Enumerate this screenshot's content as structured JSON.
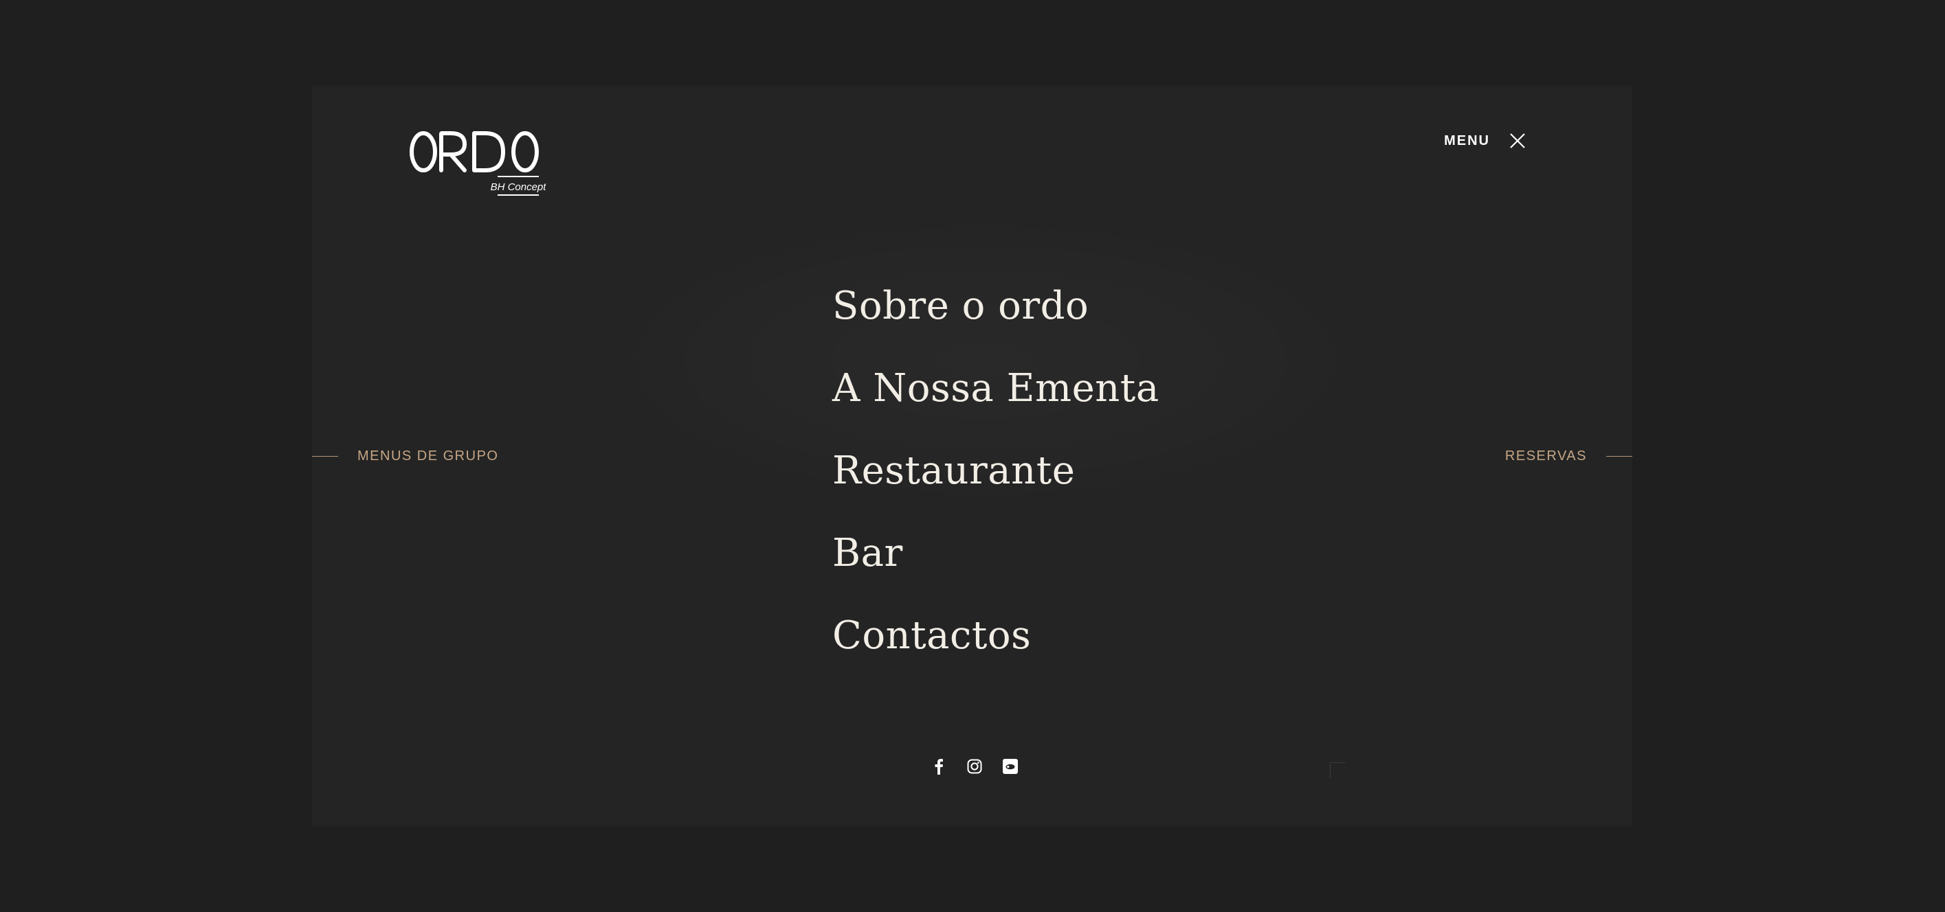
{
  "brand": {
    "name": "ORDO",
    "tagline": "BH Concept"
  },
  "header": {
    "menu_label": "MENU",
    "close_icon": "close-icon"
  },
  "side_links": {
    "left": "MENUS DE GRUPO",
    "right": "RESERVAS"
  },
  "nav": {
    "items": [
      {
        "label": "Sobre o ordo"
      },
      {
        "label": "A Nossa Ementa"
      },
      {
        "label": "Restaurante"
      },
      {
        "label": "Bar"
      },
      {
        "label": "Contactos"
      }
    ]
  },
  "social": {
    "icons": [
      "facebook-icon",
      "instagram-icon",
      "booking-icon"
    ]
  },
  "colors": {
    "background": "#1f1f1f",
    "panel": "#242424",
    "accent_gold": "#c5a685",
    "text_light": "#f2eee6"
  }
}
